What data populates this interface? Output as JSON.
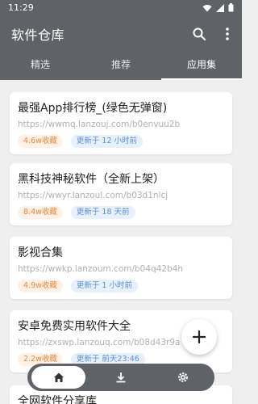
{
  "status": {
    "time": "11:29"
  },
  "appbar": {
    "title": "软件仓库"
  },
  "tabs": [
    {
      "label": "精选"
    },
    {
      "label": "推荐"
    },
    {
      "label": "应用集",
      "active": true
    }
  ],
  "cards": [
    {
      "title": "最强App排行榜_(绿色无弹窗)",
      "url": "https://wwmq.lanzouj.com/b0envuu2b",
      "downloads": "4.6w收藏",
      "updated": "更新于 12 小时前"
    },
    {
      "title": "黑科技神秘软件（全新上架）",
      "url": "https://wwyr.lanzoul.com/b03d1nlcj",
      "downloads": "8.4w收藏",
      "updated": "更新于 18 天前"
    },
    {
      "title": "影视合集",
      "url": "https://wwkp.lanzoum.com/b04q42b4h",
      "downloads": "4.9w收藏",
      "updated": "更新于 1 小时前"
    },
    {
      "title": "安卓免费实用软件大全",
      "url": "https://zxswp.lanzouq.com/b08d43r9a",
      "downloads": "2.2w收藏",
      "updated": "更新于 前天23:46"
    },
    {
      "title": "全网软件分享库",
      "url": "",
      "downloads": "",
      "updated": ""
    }
  ],
  "colors": {
    "appbar": "#5f6368",
    "badge_orange": "#e8883a",
    "badge_blue": "#5b8fd7"
  },
  "icons": {
    "search": "search-icon",
    "more": "more-vert-icon",
    "fab": "plus-icon",
    "nav": [
      "home-icon",
      "download-icon",
      "settings-icon"
    ]
  }
}
